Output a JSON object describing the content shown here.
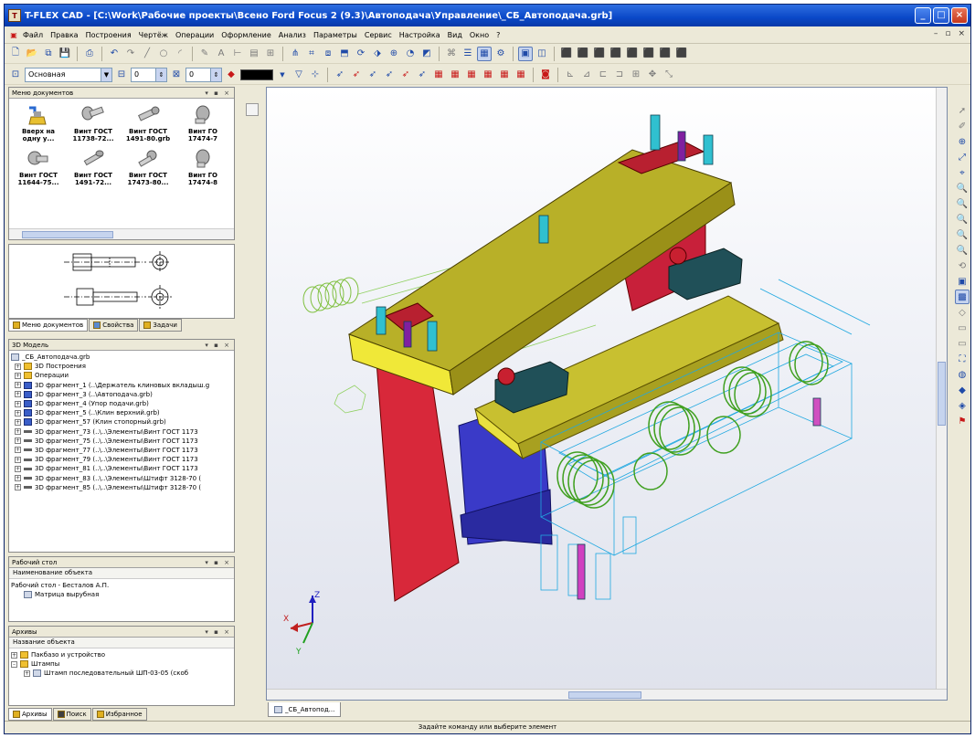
{
  "window": {
    "title": "T-FLEX CAD - [C:\\Work\\Рабочие проекты\\Всено Ford Focus 2 (9.3)\\Автоподача\\Управление\\_СБ_Автоподача.grb]",
    "app_icon": "T"
  },
  "menu": {
    "items": [
      "Файл",
      "Правка",
      "Построения",
      "Чертёж",
      "Операции",
      "Оформление",
      "Анализ",
      "Параметры",
      "Сервис",
      "Настройка",
      "Вид",
      "Окно",
      "?"
    ],
    "mdi_controls": [
      "–",
      "▫",
      "×"
    ]
  },
  "toolbar2": {
    "layer_combo": "Основная",
    "level_value": "0",
    "priority_value": "0"
  },
  "doc_menu": {
    "title": "Меню документов",
    "items": [
      {
        "line1": "Вверх на",
        "line2": "одну у..."
      },
      {
        "line1": "Винт ГОСТ",
        "line2": "11738-72..."
      },
      {
        "line1": "Винт ГОСТ",
        "line2": "1491-80.grb"
      },
      {
        "line1": "Винт ГО",
        "line2": "17474-7"
      },
      {
        "line1": "Винт ГОСТ",
        "line2": "11644-75..."
      },
      {
        "line1": "Винт ГОСТ",
        "line2": "1491-72..."
      },
      {
        "line1": "Винт ГОСТ",
        "line2": "17473-80..."
      },
      {
        "line1": "Винт ГО",
        "line2": "17474-8"
      }
    ]
  },
  "tabs1": [
    "Меню документов",
    "Свойства",
    "Задачи"
  ],
  "model_panel": {
    "title": "3D Модель",
    "rows": [
      {
        "indent": 0,
        "icon": "file",
        "text": "_СБ_Автоподача.grb"
      },
      {
        "indent": 1,
        "icon": "folder",
        "text": "3D Построения"
      },
      {
        "indent": 1,
        "icon": "folder",
        "text": "Операции"
      },
      {
        "indent": 1,
        "icon": "frag",
        "text": "3D фрагмент_1 (..\\Держатель клиновых вкладыш.g"
      },
      {
        "indent": 1,
        "icon": "frag",
        "text": "3D фрагмент_3 (..\\Автоподача.grb)"
      },
      {
        "indent": 1,
        "icon": "frag",
        "text": "3D фрагмент_4 (Упор подачи.grb)"
      },
      {
        "indent": 1,
        "icon": "frag",
        "text": "3D фрагмент_5 (..\\Клин верхний.grb)"
      },
      {
        "indent": 1,
        "icon": "frag",
        "text": "3D фрагмент_57 (Клин стопорный.grb)"
      },
      {
        "indent": 1,
        "icon": "bolt",
        "text": "3D фрагмент_73 (..\\..\\Элементы\\Винт ГОСТ 1173"
      },
      {
        "indent": 1,
        "icon": "bolt",
        "text": "3D фрагмент_75 (..\\..\\Элементы\\Винт ГОСТ 1173"
      },
      {
        "indent": 1,
        "icon": "bolt",
        "text": "3D фрагмент_77 (..\\..\\Элементы\\Винт ГОСТ 1173"
      },
      {
        "indent": 1,
        "icon": "bolt",
        "text": "3D фрагмент_79 (..\\..\\Элементы\\Винт ГОСТ 1173"
      },
      {
        "indent": 1,
        "icon": "bolt",
        "text": "3D фрагмент_81 (..\\..\\Элементы\\Винт ГОСТ 1173"
      },
      {
        "indent": 1,
        "icon": "bolt",
        "text": "3D фрагмент_83 (..\\..\\Элементы\\Штифт 3128-70 ("
      },
      {
        "indent": 1,
        "icon": "bolt",
        "text": "3D фрагмент_85 (..\\..\\Элементы\\Штифт 3128-70 ("
      }
    ]
  },
  "work_panel": {
    "title": "Рабочий стол",
    "header": "Наименование объекта",
    "rows": [
      "Рабочий стол - Бесталов А.П.",
      "Матрица вырубная"
    ]
  },
  "archive_panel": {
    "title": "Архивы",
    "header": "Название объекта",
    "rows": [
      "Пакбазо и устройство",
      "Штампы",
      "Штамп последовательный ШП-03-05 (скоб"
    ]
  },
  "tabs2": [
    "Архивы",
    "Поиск",
    "Избранное"
  ],
  "doc_tab": "_СБ_Автопод...",
  "status": "Задайте команду или выберите элемент",
  "axes": {
    "x": "X",
    "y": "Y",
    "z": "Z"
  },
  "icons": {
    "toolbar1": [
      "new-icon",
      "open-icon",
      "save-icon",
      "print-icon",
      "undo-icon",
      "redo-icon",
      "line-icon",
      "text-icon",
      "dimension-icon",
      "hatch-icon",
      "3d-node-icon",
      "3d-profile-icon",
      "extrude-icon",
      "rotate-icon",
      "loft-icon",
      "boolean-icon",
      "fillet-icon",
      "properties-icon",
      "view-front-icon",
      "view-top-icon",
      "view-left-icon",
      "view-iso-icon",
      "view-back-icon",
      "view-right-icon",
      "view-bottom-icon"
    ],
    "right_toolbar": [
      "select-icon",
      "zoom-window-icon",
      "zoom-all-icon",
      "pan-icon",
      "zoom-in-icon",
      "zoom-out-icon",
      "rotate-view-icon",
      "orbit-icon",
      "render-icon",
      "shaded-icon",
      "wireframe-icon",
      "section-icon",
      "camera-icon",
      "light-icon",
      "material-icon"
    ]
  }
}
